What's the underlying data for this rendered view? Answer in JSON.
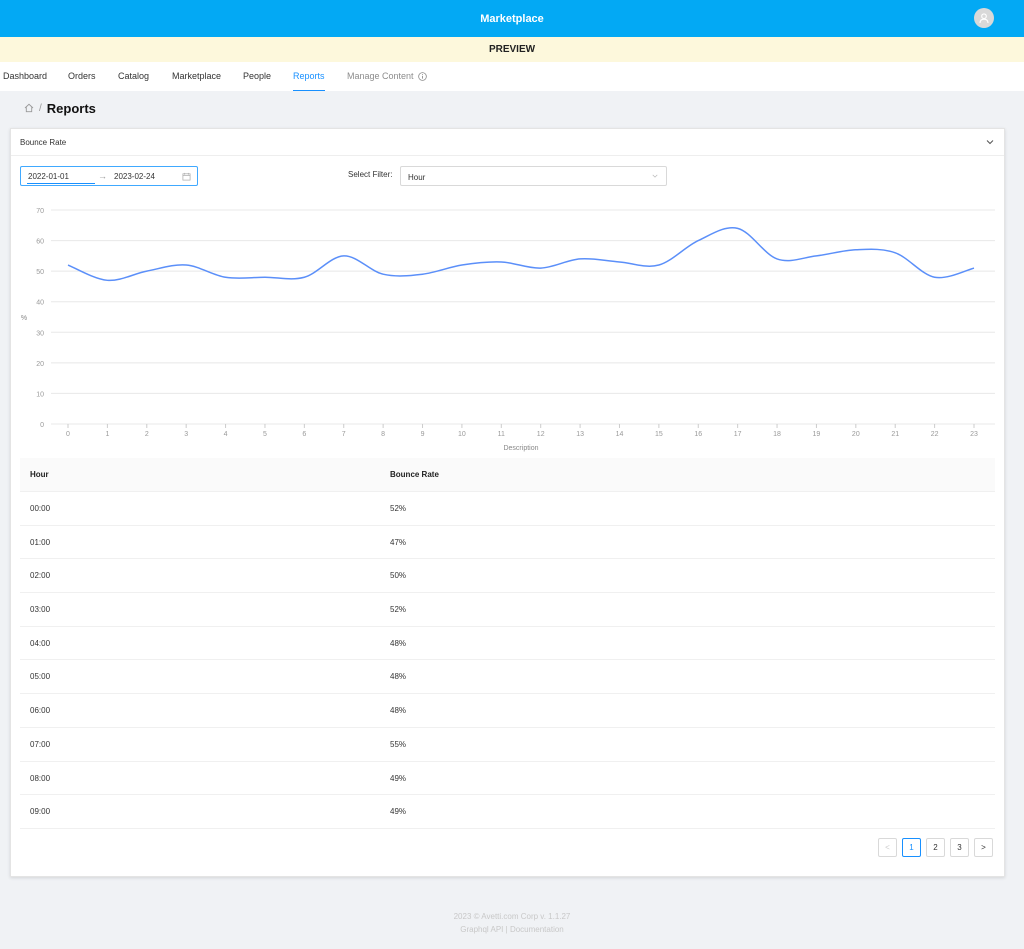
{
  "app": {
    "title": "Marketplace",
    "preview_label": "PREVIEW",
    "avatar_icon": "user-icon"
  },
  "nav": {
    "items": [
      {
        "label": "Dashboard"
      },
      {
        "label": "Orders"
      },
      {
        "label": "Catalog"
      },
      {
        "label": "Marketplace"
      },
      {
        "label": "People"
      },
      {
        "label": "Reports",
        "active": true
      },
      {
        "label": "Manage Content",
        "icon": "info-icon"
      }
    ]
  },
  "breadcrumb": {
    "home_icon": "home-icon",
    "separator": "/",
    "current": "Reports"
  },
  "panel": {
    "title": "Bounce Rate",
    "collapse_icon": "chevron-down-icon",
    "date_start": "2022-01-01",
    "date_end": "2023-02-24",
    "arrow": "→",
    "filter_label": "Select Filter:",
    "filter_value": "Hour"
  },
  "chart_data": {
    "type": "line",
    "xlabel": "Description",
    "ylabel": "%",
    "x": [
      0,
      1,
      2,
      3,
      4,
      5,
      6,
      7,
      8,
      9,
      10,
      11,
      12,
      13,
      14,
      15,
      16,
      17,
      18,
      19,
      20,
      21,
      22,
      23
    ],
    "y": [
      52,
      47,
      50,
      52,
      48,
      48,
      48,
      55,
      49,
      49,
      52,
      53,
      51,
      54,
      53,
      52,
      60,
      64,
      54,
      55,
      57,
      56,
      48,
      51
    ],
    "ylim": [
      0,
      70
    ],
    "yticks": [
      0,
      10,
      20,
      30,
      40,
      50,
      60,
      70
    ],
    "grid": true,
    "line_color": "#5b8ff9"
  },
  "table": {
    "headers": [
      "Hour",
      "Bounce Rate"
    ],
    "rows": [
      [
        "00:00",
        "52%"
      ],
      [
        "01:00",
        "47%"
      ],
      [
        "02:00",
        "50%"
      ],
      [
        "03:00",
        "52%"
      ],
      [
        "04:00",
        "48%"
      ],
      [
        "05:00",
        "48%"
      ],
      [
        "06:00",
        "48%"
      ],
      [
        "07:00",
        "55%"
      ],
      [
        "08:00",
        "49%"
      ],
      [
        "09:00",
        "49%"
      ]
    ]
  },
  "pagination": {
    "prev": "<",
    "pages": [
      "1",
      "2",
      "3"
    ],
    "current": "1",
    "next": ">"
  },
  "footer": {
    "copyright": "2023 © Avetti.com Corp v. 1.1.27",
    "api_link": "Graphql API",
    "divider": "|",
    "docs_link": "Documentation"
  }
}
